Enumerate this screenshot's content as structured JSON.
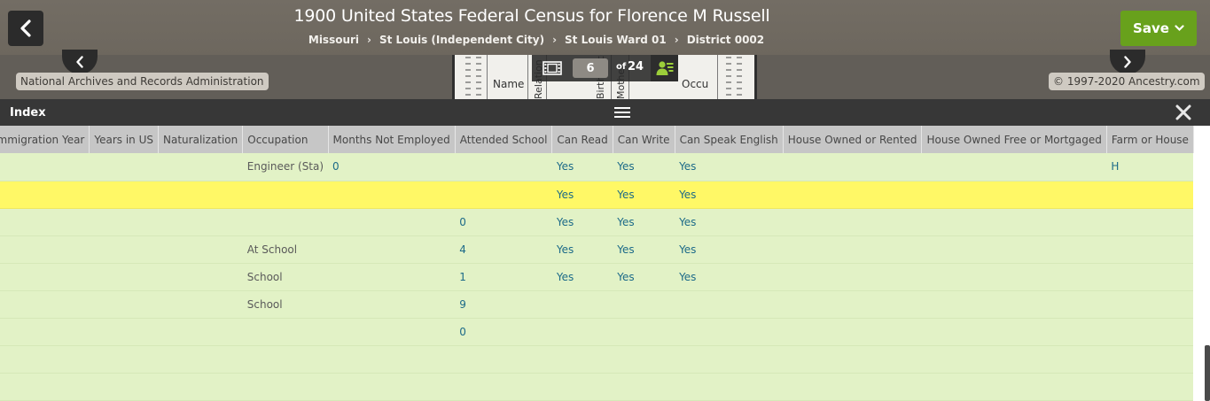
{
  "header": {
    "title": "1900 United States Federal Census for Florence M Russell",
    "breadcrumb": [
      "Missouri",
      "St Louis (Independent City)",
      "St Louis Ward 01",
      "District 0002"
    ],
    "breadcrumb_separator": "›",
    "save_label": "Save",
    "colors": {
      "header_bg": "#736d64",
      "save_green": "#68a11c"
    }
  },
  "viewer": {
    "source": "National Archives and Records Administration",
    "copyright": "© 1997-2020 Ancestry.com",
    "page_current": "6",
    "page_of": "of",
    "page_total": "24",
    "thumb_labels": {
      "name": "Name",
      "relation": "Relation",
      "birthplace": "Birthplace",
      "mother": "Mother",
      "occupation": "Occu"
    },
    "icons": [
      "chevron-left-icon",
      "chevron-right-icon",
      "filmstrip-icon",
      "person-list-icon"
    ]
  },
  "index": {
    "label": "Index",
    "icons": [
      "hamburger-menu-icon",
      "close-icon"
    ]
  },
  "table": {
    "columns": [
      "Immigration Year",
      "Years in US",
      "Naturalization",
      "Occupation",
      "Months Not Employed",
      "Attended School",
      "Can Read",
      "Can Write",
      "Can Speak English",
      "House Owned or Rented",
      "House Owned Free or Mortgaged",
      "Farm or House"
    ],
    "rows": [
      [
        "",
        "",
        "",
        "Engineer (Sta)",
        "0",
        "",
        "Yes",
        "Yes",
        "Yes",
        "",
        "",
        "H"
      ],
      [
        "",
        "",
        "",
        "",
        "",
        "",
        "Yes",
        "Yes",
        "Yes",
        "",
        "",
        ""
      ],
      [
        "",
        "",
        "",
        "",
        "",
        "0",
        "Yes",
        "Yes",
        "Yes",
        "",
        "",
        ""
      ],
      [
        "",
        "",
        "",
        "At School",
        "",
        "4",
        "Yes",
        "Yes",
        "Yes",
        "",
        "",
        ""
      ],
      [
        "",
        "",
        "",
        "School",
        "",
        "1",
        "Yes",
        "Yes",
        "Yes",
        "",
        "",
        ""
      ],
      [
        "",
        "",
        "",
        "School",
        "",
        "9",
        "",
        "",
        "",
        "",
        "",
        ""
      ],
      [
        "",
        "",
        "",
        "",
        "",
        "0",
        "",
        "",
        "",
        "",
        "",
        ""
      ],
      [
        "",
        "",
        "",
        "",
        "",
        "",
        "",
        "",
        "",
        "",
        "",
        ""
      ],
      [
        "",
        "",
        "",
        "",
        "",
        "",
        "",
        "",
        "",
        "",
        "",
        ""
      ]
    ],
    "highlighted_row": 1,
    "colors": {
      "row_bg": "#e2f2c6",
      "highlight_bg": "#fff866",
      "header_bg": "#c6c6c6",
      "link": "#1c6a88"
    }
  }
}
